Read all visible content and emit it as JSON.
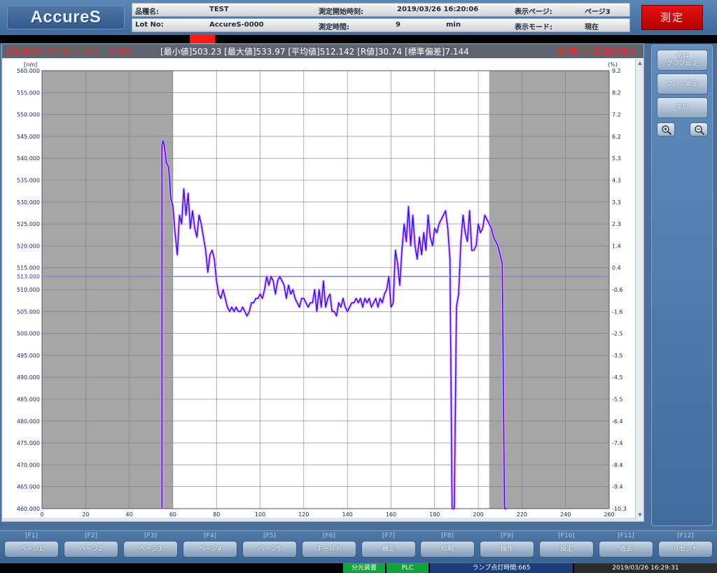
{
  "app": {
    "logo": "AccureS",
    "measure_button": "測定"
  },
  "header": {
    "product_label": "品種名:",
    "product_value": "TEST",
    "start_label": "測定開始時刻:",
    "start_value": "2019/03/26 16:20:06",
    "page_label": "表示ページ:",
    "page_value": "ページ3",
    "lot_label": "Lot No:",
    "lot_value": "AccureS-0000",
    "time_label": "測定時間:",
    "time_value": "9",
    "time_unit": "min",
    "mode_label": "表示モード:",
    "mode_value": "現在"
  },
  "stats_bar": {
    "time_text": "[時刻]16:29:19 [トラバース]80",
    "stats_text": "[最小値]503.23 [最大値]533.97 [平均値]512.142 [R値]30.74 [標準偏差]7.144",
    "layer_text": "第1層 20 回重ね書き"
  },
  "side": {
    "simple_graph": "簡易\nグラフ設定",
    "graph_settings": "グラフ設定",
    "average": "平均",
    "zoom_in_icon": "zoom-in-icon",
    "zoom_out_icon": "zoom-out-icon"
  },
  "fkeys": [
    {
      "key": "[F1]",
      "label": "ページ1"
    },
    {
      "key": "[F2]",
      "label": "ページ2"
    },
    {
      "key": "[F3]",
      "label": "ページ3"
    },
    {
      "key": "[F4]",
      "label": "ページ4"
    },
    {
      "key": "[F5]",
      "label": "ページ5"
    },
    {
      "key": "[F6]",
      "label": "ホールド"
    },
    {
      "key": "[F7]",
      "label": "補正"
    },
    {
      "key": "[F8]",
      "label": "印刷"
    },
    {
      "key": "[F9]",
      "label": "操作"
    },
    {
      "key": "[F10]",
      "label": "設定"
    },
    {
      "key": "[F11]",
      "label": "過去"
    },
    {
      "key": "[F12]",
      "label": "リセット"
    }
  ],
  "status": {
    "spectrometer": "分光装置",
    "plc": "PLC",
    "lamp": "ランプ点灯時間:665",
    "clock": "2019/03/26 16:29:31"
  },
  "colors": {
    "line": "#1a1aff",
    "overlay": "#ff99ff",
    "reference": "#8080ff",
    "gray_region": "#a6a6a6",
    "grid": "#7a7a7a",
    "measure_red": "#e00000"
  },
  "chart_data": {
    "type": "line",
    "y_unit": "[nm]",
    "y2_unit": "(%)",
    "xlim": [
      0,
      260
    ],
    "ylim": [
      460,
      560
    ],
    "y2lim": [
      -10.3,
      9.2
    ],
    "x_ticks": [
      "0",
      "20",
      "40",
      "60",
      "80",
      "100",
      "120",
      "140",
      "160",
      "180",
      "200",
      "220",
      "240",
      "260"
    ],
    "y_ticks": [
      "560.000",
      "555.000",
      "550.000",
      "545.000",
      "540.000",
      "535.000",
      "530.000",
      "525.000",
      "520.000",
      "515.000",
      "510.000",
      "505.000",
      "500.000",
      "495.000",
      "490.000",
      "485.000",
      "480.000",
      "475.000",
      "470.000",
      "465.000",
      "460.000"
    ],
    "y2_ticks": [
      "9.2",
      "8.2",
      "7.2",
      "6.2",
      "5.3",
      "4.3",
      "3.3",
      "2.3",
      "1.4",
      "0.4",
      "-0.6",
      "-1.6",
      "-2.5",
      "-3.5",
      "-4.5",
      "-5.5",
      "-6.4",
      "-7.4",
      "-8.4",
      "-9.4",
      "-10.3"
    ],
    "reference_line": {
      "value": 513.0,
      "label": "513.000"
    },
    "shaded_ranges": [
      [
        0,
        60
      ],
      [
        205,
        260
      ]
    ],
    "grid": true,
    "x": [
      55,
      55,
      55.5,
      56,
      57,
      58,
      58.5,
      59,
      60,
      61,
      62,
      63,
      64,
      65,
      66,
      67,
      68,
      69,
      70,
      71,
      72,
      73,
      74,
      75,
      76,
      77,
      78,
      79,
      80,
      81,
      82,
      83,
      84,
      85,
      86,
      87,
      88,
      89,
      90,
      91,
      92,
      93,
      94,
      95,
      96,
      97,
      98,
      99,
      100,
      101,
      102,
      103,
      104,
      105,
      106,
      107,
      108,
      109,
      110,
      111,
      112,
      113,
      114,
      115,
      116,
      117,
      118,
      119,
      120,
      121,
      122,
      123,
      124,
      125,
      126,
      127,
      128,
      129,
      130,
      131,
      132,
      133,
      134,
      135,
      136,
      137,
      138,
      139,
      140,
      141,
      142,
      143,
      144,
      145,
      146,
      147,
      148,
      149,
      150,
      151,
      152,
      153,
      154,
      155,
      156,
      157,
      158,
      159,
      160,
      161,
      162,
      163,
      164,
      165,
      166,
      167,
      168,
      169,
      170,
      171,
      172,
      173,
      174,
      175,
      176,
      177,
      178,
      179,
      180,
      181,
      182,
      183,
      184,
      185,
      186,
      187,
      188,
      189,
      190,
      191,
      192,
      193,
      194,
      195,
      196,
      197,
      198,
      199,
      200,
      201,
      202,
      203,
      204,
      205,
      206,
      207,
      208,
      209,
      210,
      211,
      212,
      213,
      213
    ],
    "y": [
      460,
      543,
      544,
      543,
      539,
      538,
      535,
      531,
      529,
      523,
      518,
      527,
      525,
      533,
      527,
      532,
      524,
      528,
      524,
      522,
      527,
      525,
      522,
      519,
      514,
      518,
      519,
      517,
      512,
      509,
      508,
      510,
      508,
      506,
      505,
      506,
      505,
      506,
      505,
      505,
      506,
      505,
      504,
      505,
      507,
      507,
      508,
      508,
      509,
      508,
      510,
      513,
      511,
      513,
      512,
      509,
      512,
      513,
      512,
      511,
      508,
      511,
      509,
      510,
      508,
      507,
      506,
      508,
      508,
      507,
      506,
      507,
      507,
      510,
      505,
      510,
      506,
      512,
      506,
      508,
      509,
      505,
      505,
      504,
      507,
      506,
      508,
      506,
      505,
      506,
      507,
      507,
      508,
      507,
      508,
      506,
      508,
      507,
      508,
      506,
      507,
      508,
      506,
      508,
      507,
      509,
      510,
      513,
      506,
      507,
      519,
      516,
      511,
      519,
      525,
      521,
      529,
      520,
      527,
      520,
      517,
      522,
      518,
      523,
      519,
      527,
      522,
      520,
      524,
      523,
      525,
      526,
      527,
      528,
      524,
      517,
      460,
      460,
      506,
      509,
      521,
      527,
      523,
      521,
      528,
      519,
      519,
      520,
      525,
      523,
      524,
      527,
      526,
      525,
      524,
      522,
      521,
      520,
      518,
      516,
      460,
      460,
      460
    ]
  }
}
